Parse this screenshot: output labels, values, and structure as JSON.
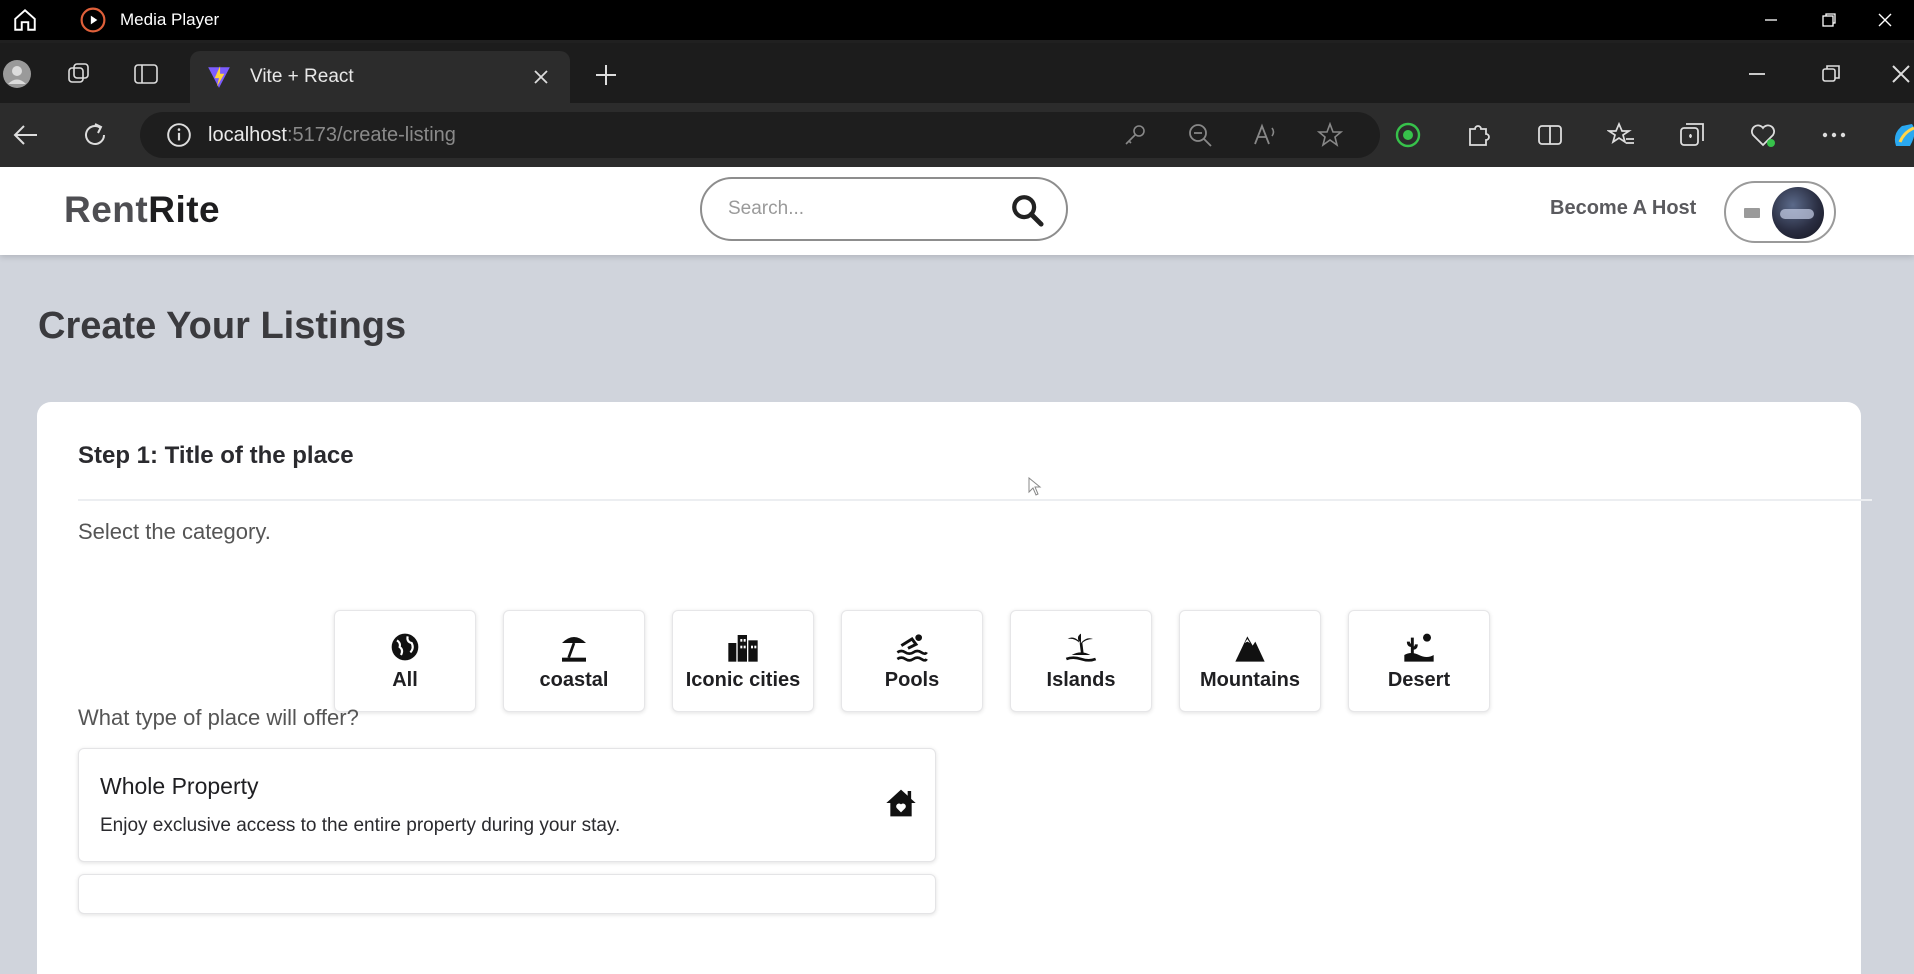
{
  "media_player": {
    "title": "Media Player"
  },
  "browser": {
    "tab_label": "Vite + React",
    "url_host": "localhost",
    "url_rest": ":5173/create-listing"
  },
  "navbar": {
    "logo_part1": "Rent",
    "logo_part2": "Rite",
    "search_placeholder": "Search...",
    "become_host": "Become A Host"
  },
  "page": {
    "title": "Create Your Listings",
    "step_title": "Step 1: Title of the place",
    "category_label": "Select the category.",
    "categories": [
      {
        "label": "All",
        "icon": "globe-icon"
      },
      {
        "label": "coastal",
        "icon": "beach-umbrella-icon"
      },
      {
        "label": "Iconic cities",
        "icon": "city-buildings-icon"
      },
      {
        "label": "Pools",
        "icon": "swimming-pool-icon"
      },
      {
        "label": "Islands",
        "icon": "island-palm-icon"
      },
      {
        "label": "Mountains",
        "icon": "mountain-icon"
      },
      {
        "label": "Desert",
        "icon": "desert-icon"
      }
    ],
    "place_type_label": "What type of place will offer?",
    "place_types": [
      {
        "title": "Whole Property",
        "desc": "Enjoy exclusive access to the entire property during your stay.",
        "icon": "house-icon"
      }
    ]
  },
  "colors": {
    "page_bg": "#d0d4dc",
    "card_bg": "#ffffff",
    "titlebar": "#000000"
  }
}
